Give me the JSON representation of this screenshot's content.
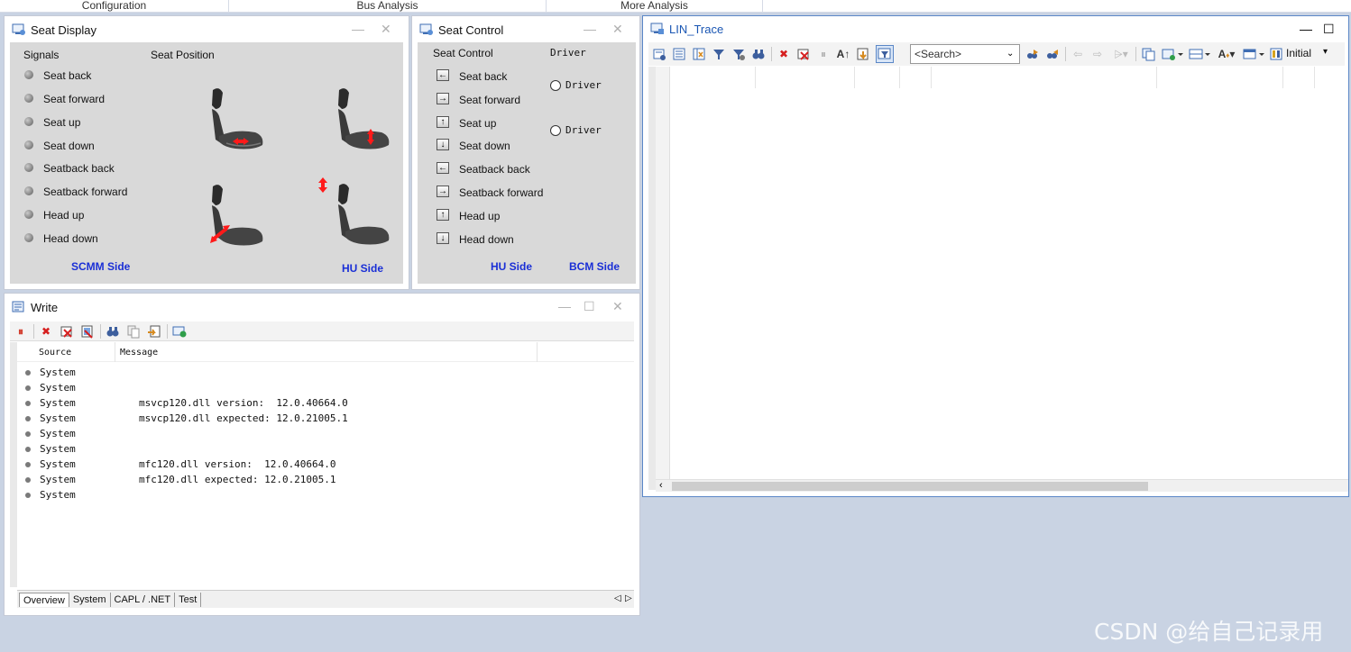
{
  "menu": [
    "Configuration",
    "Bus Analysis",
    "More Analysis"
  ],
  "seat_display": {
    "title": "Seat Display",
    "col_signals": "Signals",
    "col_position": "Seat Position",
    "signals": [
      "Seat back",
      "Seat forward",
      "Seat up",
      "Seat down",
      "Seatback back",
      "Seatback forward",
      "Head up",
      "Head down"
    ],
    "left_side": "SCMM Side",
    "right_side": "HU Side"
  },
  "seat_control": {
    "title": "Seat Control",
    "col_control": "Seat Control",
    "col_driver": "Driver",
    "buttons": [
      {
        "label": "Seat back",
        "arrow": "←"
      },
      {
        "label": "Seat forward",
        "arrow": "→"
      },
      {
        "label": "Seat up",
        "arrow": "↑"
      },
      {
        "label": "Seat down",
        "arrow": "↓"
      },
      {
        "label": "Seatback back",
        "arrow": "←"
      },
      {
        "label": "Seatback forward",
        "arrow": "→"
      },
      {
        "label": "Head up",
        "arrow": "↑"
      },
      {
        "label": "Head down",
        "arrow": "↓"
      }
    ],
    "radio1": "Driver",
    "radio2": "Driver",
    "left_side": "HU Side",
    "right_side": "BCM Side"
  },
  "write": {
    "title": "Write",
    "col_source": "Source",
    "col_message": "Message",
    "rows": [
      {
        "source": "System",
        "message": ""
      },
      {
        "source": "System",
        "message": ""
      },
      {
        "source": "System",
        "message": "msvcp120.dll version:  12.0.40664.0"
      },
      {
        "source": "System",
        "message": "msvcp120.dll expected: 12.0.21005.1"
      },
      {
        "source": "System",
        "message": ""
      },
      {
        "source": "System",
        "message": ""
      },
      {
        "source": "System",
        "message": "mfc120.dll version:  12.0.40664.0"
      },
      {
        "source": "System",
        "message": "mfc120.dll expected: 12.0.21005.1"
      },
      {
        "source": "System",
        "message": ""
      }
    ],
    "tabs": [
      "Overview",
      "System",
      "CAPL / .NET",
      "Test"
    ]
  },
  "trace": {
    "title": "LIN_Trace",
    "search_placeholder": "<Search>",
    "filter_value": "Initial"
  },
  "watermark": "CSDN @给自己记录用",
  "colors": {
    "side_label": "#1a2fd6",
    "panel_bg": "#d9d9d9",
    "desktop": "#c9d3e3",
    "trace_title": "#1a56b3"
  }
}
